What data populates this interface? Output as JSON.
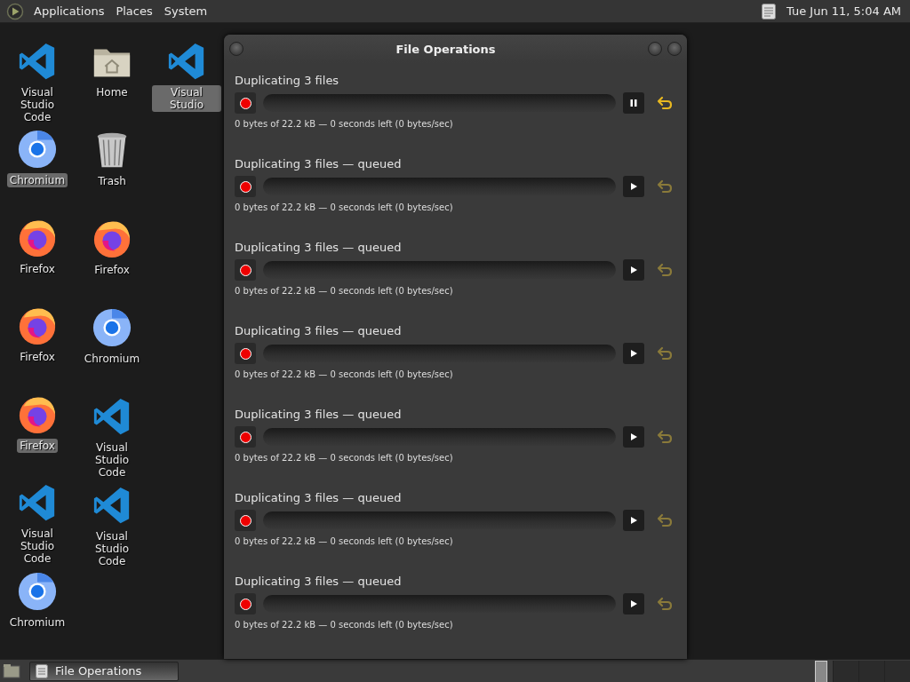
{
  "top_panel": {
    "menus": [
      "Applications",
      "Places",
      "System"
    ],
    "clock": "Tue Jun 11,  5:04 AM"
  },
  "desktop": {
    "columns": [
      {
        "icons": [
          {
            "label": "Visual Studio Code",
            "kind": "vscode",
            "selected": false
          },
          {
            "label": "Chromium",
            "kind": "chromium",
            "selected": true
          },
          {
            "label": "Firefox",
            "kind": "firefox",
            "selected": false
          },
          {
            "label": "Firefox",
            "kind": "firefox",
            "selected": false
          },
          {
            "label": "Firefox",
            "kind": "firefox",
            "selected": true
          },
          {
            "label": "Visual Studio Code",
            "kind": "vscode",
            "selected": false
          },
          {
            "label": "Chromium",
            "kind": "chromium",
            "selected": false
          }
        ]
      },
      {
        "icons": [
          {
            "label": "Home",
            "kind": "home",
            "selected": false
          },
          {
            "label": "Trash",
            "kind": "trash",
            "selected": false
          },
          {
            "label": "Firefox",
            "kind": "firefox",
            "selected": false
          },
          {
            "label": "Chromium",
            "kind": "chromium",
            "selected": false
          },
          {
            "label": "Visual Studio Code",
            "kind": "vscode",
            "selected": false
          },
          {
            "label": "Visual Studio Code",
            "kind": "vscode",
            "selected": false
          }
        ]
      },
      {
        "icons": [
          {
            "label": "Visual Studio",
            "kind": "vscode",
            "selected": true
          }
        ]
      }
    ]
  },
  "window": {
    "title": "File Operations",
    "operations": [
      {
        "title": "Duplicating 3 files",
        "level": 0,
        "running": true,
        "revert_enabled": true,
        "status": "0 bytes of 22.2 kB — 0 seconds left (0 bytes/sec)"
      },
      {
        "title": "Duplicating 3 files — queued",
        "level": 0,
        "running": false,
        "revert_enabled": false,
        "status": "0 bytes of 22.2 kB — 0 seconds left (0 bytes/sec)"
      },
      {
        "title": "Duplicating 3 files — queued",
        "level": 0,
        "running": false,
        "revert_enabled": false,
        "status": "0 bytes of 22.2 kB — 0 seconds left (0 bytes/sec)"
      },
      {
        "title": "Duplicating 3 files — queued",
        "level": 0,
        "running": false,
        "revert_enabled": false,
        "status": "0 bytes of 22.2 kB — 0 seconds left (0 bytes/sec)"
      },
      {
        "title": "Duplicating 3 files — queued",
        "level": 0,
        "running": false,
        "revert_enabled": false,
        "status": "0 bytes of 22.2 kB — 0 seconds left (0 bytes/sec)"
      },
      {
        "title": "Duplicating 3 files — queued",
        "level": 0,
        "running": false,
        "revert_enabled": false,
        "status": "0 bytes of 22.2 kB — 0 seconds left (0 bytes/sec)"
      },
      {
        "title": "Duplicating 3 files — queued",
        "level": 0,
        "running": false,
        "revert_enabled": false,
        "status": "0 bytes of 22.2 kB — 0 seconds left (0 bytes/sec)"
      }
    ]
  },
  "taskbar": {
    "tasks": [
      {
        "label": "File Operations",
        "selected": true
      }
    ]
  }
}
